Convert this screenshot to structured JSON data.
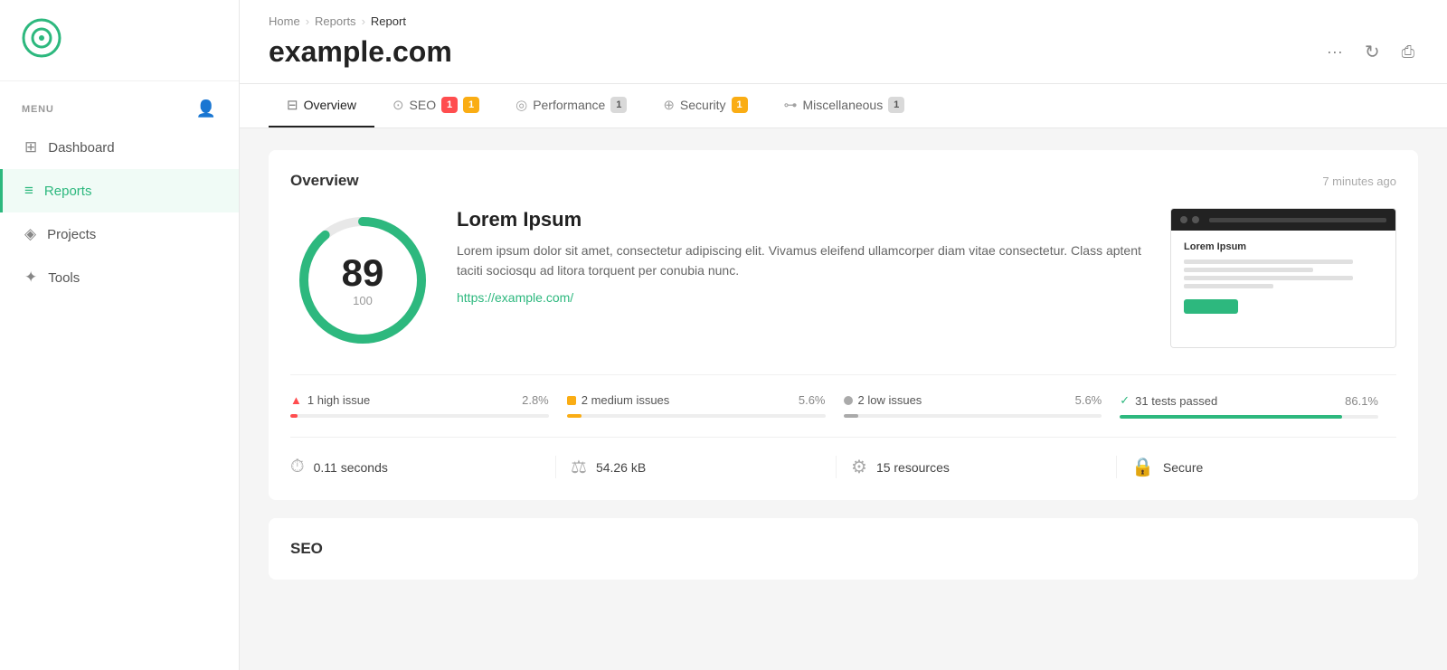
{
  "sidebar": {
    "menu_label": "MENU",
    "items": [
      {
        "id": "dashboard",
        "label": "Dashboard",
        "icon": "⊞",
        "active": false
      },
      {
        "id": "reports",
        "label": "Reports",
        "icon": "≡",
        "active": true
      },
      {
        "id": "projects",
        "label": "Projects",
        "icon": "◈",
        "active": false
      },
      {
        "id": "tools",
        "label": "Tools",
        "icon": "✦",
        "active": false
      }
    ]
  },
  "breadcrumb": {
    "home": "Home",
    "reports": "Reports",
    "current": "Report"
  },
  "page_title": "example.com",
  "topbar_actions": {
    "more": "···",
    "refresh": "↻",
    "print": "⎙"
  },
  "tabs": [
    {
      "id": "overview",
      "label": "Overview",
      "badge": null,
      "active": true
    },
    {
      "id": "seo",
      "label": "SEO",
      "badge_red": "1",
      "badge_yellow": "1",
      "active": false
    },
    {
      "id": "performance",
      "label": "Performance",
      "badge_gray": "1",
      "active": false
    },
    {
      "id": "security",
      "label": "Security",
      "badge_yellow": "1",
      "active": false
    },
    {
      "id": "miscellaneous",
      "label": "Miscellaneous",
      "badge_gray": "1",
      "active": false
    }
  ],
  "overview": {
    "title": "Overview",
    "time": "7 minutes ago",
    "score": {
      "value": "89",
      "total": "100",
      "percent": 89
    },
    "info_title": "Lorem Ipsum",
    "info_desc": "Lorem ipsum dolor sit amet, consectetur adipiscing elit. Vivamus eleifend ullamcorper diam vitae consectetur. Class aptent taciti sociosqu ad litora torquent per conubia nunc.",
    "info_link": "https://example.com/",
    "preview_title": "Lorem Ipsum",
    "issues": [
      {
        "id": "high",
        "icon_type": "triangle",
        "label": "1 high issue",
        "pct": "2.8%",
        "fill_type": "red",
        "fill_pct": 2.8
      },
      {
        "id": "medium",
        "icon_type": "square",
        "label": "2 medium issues",
        "pct": "5.6%",
        "fill_type": "yellow",
        "fill_pct": 5.6
      },
      {
        "id": "low",
        "icon_type": "circle-gray",
        "label": "2 low issues",
        "pct": "5.6%",
        "fill_type": "gray",
        "fill_pct": 5.6
      },
      {
        "id": "passed",
        "icon_type": "check",
        "label": "31 tests passed",
        "pct": "86.1%",
        "fill_type": "green",
        "fill_pct": 86.1
      }
    ],
    "stats": [
      {
        "id": "time",
        "icon": "⏱",
        "value": "0.11 seconds"
      },
      {
        "id": "size",
        "icon": "⚖",
        "value": "54.26 kB"
      },
      {
        "id": "resources",
        "icon": "⚙",
        "value": "15 resources"
      },
      {
        "id": "security",
        "icon": "🔒",
        "value": "Secure"
      }
    ]
  },
  "seo_section": {
    "title": "SEO"
  }
}
